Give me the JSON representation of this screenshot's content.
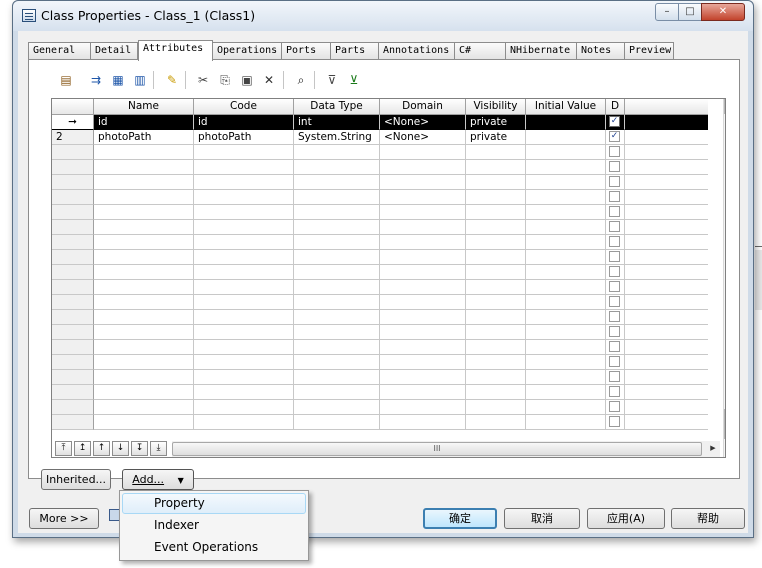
{
  "window": {
    "title": "Class Properties - Class_1 (Class1)",
    "min_glyph": "–",
    "max_glyph": "□",
    "close_glyph": "✕"
  },
  "tabs": [
    {
      "label": "General",
      "active": false
    },
    {
      "label": "Detail",
      "active": false
    },
    {
      "label": "Attributes",
      "active": true
    },
    {
      "label": "Operations",
      "active": false
    },
    {
      "label": "Ports",
      "active": false
    },
    {
      "label": "Parts",
      "active": false
    },
    {
      "label": "Annotations",
      "active": false
    },
    {
      "label": "C#",
      "active": false
    },
    {
      "label": "NHibernate",
      "active": false
    },
    {
      "label": "Notes",
      "active": false
    },
    {
      "label": "Preview",
      "active": false
    }
  ],
  "toolbar": {
    "icons": [
      "properties-icon",
      "add-row-icon",
      "insert-row-icon",
      "add-attributes-icon",
      "find-icon",
      "cut-icon",
      "copy-icon",
      "paste-icon",
      "delete-icon",
      "binoculars-icon",
      "filter-icon",
      "clear-filter-icon"
    ]
  },
  "grid": {
    "columns": [
      "Name",
      "Code",
      "Data Type",
      "Domain",
      "Visibility",
      "Initial Value",
      "D"
    ],
    "rows": [
      {
        "marker": "➞",
        "name": "id",
        "code": "id",
        "data_type": "int",
        "domain": "<None>",
        "visibility": "private",
        "initial_value": "",
        "d": true,
        "selected": true
      },
      {
        "marker": "2",
        "name": "photoPath",
        "code": "photoPath",
        "data_type": "System.String",
        "domain": "<None>",
        "visibility": "private",
        "initial_value": "",
        "d": true,
        "selected": false
      }
    ],
    "empty_rows": 19,
    "nav_glyphs": [
      "⤒",
      "↥",
      "↑",
      "↓",
      "↧",
      "⤓"
    ],
    "hscroll_grip": "III",
    "vscroll_grip": "≡"
  },
  "buttons": {
    "inherited": "Inherited...",
    "add": "Add...",
    "add_arrow": "▼",
    "more": "More >>",
    "ok": "确定",
    "cancel": "取消",
    "apply": "应用(A)",
    "help": "帮助"
  },
  "add_menu": {
    "items": [
      {
        "label": "Property",
        "highlighted": true
      },
      {
        "label": "Indexer",
        "highlighted": false
      },
      {
        "label": "Event Operations",
        "highlighted": false
      }
    ]
  }
}
